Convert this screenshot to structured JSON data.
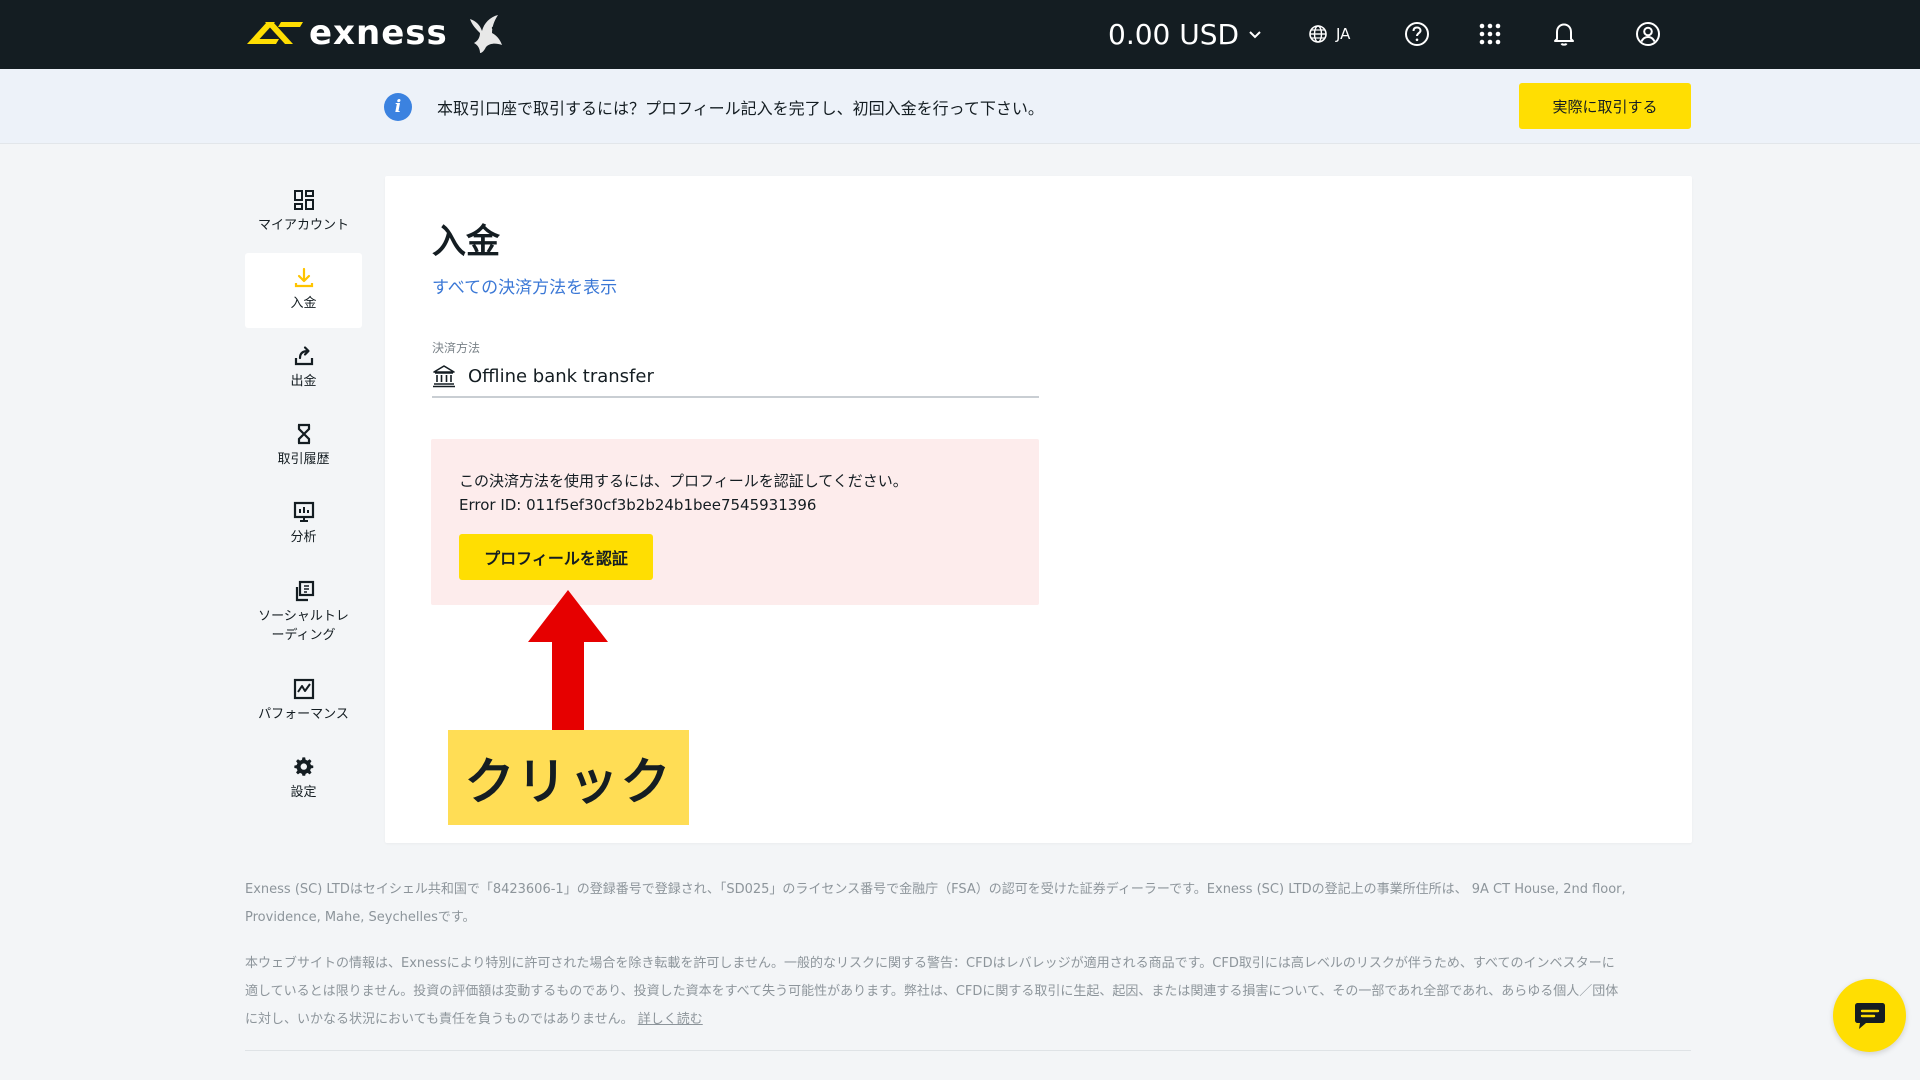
{
  "header": {
    "logo_text": "exness",
    "balance": "0.00 USD",
    "language": "JA"
  },
  "banner": {
    "message": "本取引口座で取引するには？プロフィール記入を完了し、初回入金を行って下さい。",
    "button_label": "実際に取引する"
  },
  "sidebar": {
    "items": [
      {
        "label": "マイアカウント",
        "icon": "dashboard-icon"
      },
      {
        "label": "入金",
        "icon": "download-icon"
      },
      {
        "label": "出金",
        "icon": "upload-icon"
      },
      {
        "label": "取引履歴",
        "icon": "hourglass-icon"
      },
      {
        "label": "分析",
        "icon": "analytics-icon"
      },
      {
        "label": "ソーシャルトレーディング",
        "label_line1": "ソーシャルトレ",
        "label_line2": "ーディング",
        "icon": "copy-icon"
      },
      {
        "label": "パフォーマンス",
        "icon": "performance-icon"
      },
      {
        "label": "設定",
        "icon": "gear-icon"
      }
    ],
    "active_index": 1
  },
  "main": {
    "title": "入金",
    "all_methods_link": "すべての決済方法を表示",
    "payment_method_label": "決済方法",
    "payment_method_value": "Offline bank transfer",
    "error": {
      "message": "この決済方法を使用するには、プロフィールを認証してください。",
      "error_id": "Error ID: 011f5ef30cf3b2b24b1bee7545931396",
      "button_label": "プロフィールを認証"
    }
  },
  "annotation": {
    "label": "クリック",
    "arrow_color": "#e60000",
    "label_bg": "#ffdd55"
  },
  "footer": {
    "para1_line1": "Exness (SC) LTDはセイシェル共和国で「8423606-1」の登録番号で登録され、「SD025」のライセンス番号で金融庁（FSA）の認可を受けた証券ディーラーです。Exness (SC) LTDの登記上の事業所住所は、 9A CT House, 2nd floor,",
    "para1_line2": "Providence, Mahe, Seychellesです。",
    "para2_line1": "本ウェブサイトの情報は、Exnessにより特別に許可された場合を除き転載を許可しません。一般的なリスクに関する警告：CFDはレバレッジが適用される商品です。CFD取引には高レベルのリスクが伴うため、すべてのインベスターに",
    "para2_line2": "適しているとは限りません。投資の評価額は変動するものであり、投資した資本をすべて失う可能性があります。弊社は、CFDに関する取引に生起、起因、または関連する損害について、その一部であれ全部であれ、あらゆる個人／団体",
    "para2_line3": "に対し、いかなる状況においても責任を負うものではありません。",
    "read_more": "詳しく読む"
  },
  "colors": {
    "topbar_bg": "#141d22",
    "accent_yellow": "#ffde02",
    "link_blue": "#3b78d6",
    "error_bg": "#fdecec",
    "banner_bg": "#edf2f9"
  }
}
